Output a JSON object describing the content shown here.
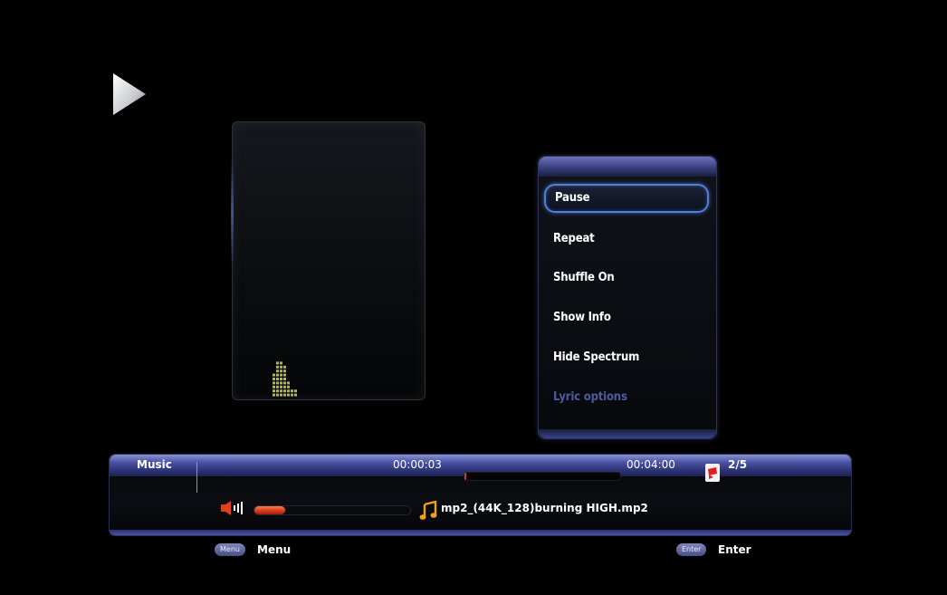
{
  "playback_state_icon": "play-icon",
  "menu": {
    "items": [
      {
        "label": "Pause",
        "selected": true,
        "enabled": true
      },
      {
        "label": "Repeat",
        "selected": false,
        "enabled": true
      },
      {
        "label": "Shuffle On",
        "selected": false,
        "enabled": true
      },
      {
        "label": "Show Info",
        "selected": false,
        "enabled": true
      },
      {
        "label": "Hide Spectrum",
        "selected": false,
        "enabled": true
      },
      {
        "label": "Lyric options",
        "selected": false,
        "enabled": false
      }
    ]
  },
  "info_bar": {
    "source_label": "Music",
    "current_time": "00:00:03",
    "total_time": "00:04:00",
    "progress_fraction": 0.0125,
    "track_position": "2/5",
    "volume_fraction": 0.2,
    "filename": "mp2_(44K_128)burning HIGH.mp2",
    "icons": {
      "volume": "speaker-volume-icon",
      "track": "playlist-icon",
      "file": "music-note-icon"
    }
  },
  "hints": {
    "menu_key": "Menu",
    "menu_label": "Menu",
    "enter_key": "Enter",
    "enter_label": "Enter"
  },
  "spectrum": {
    "levels": [
      3,
      6,
      5,
      4,
      2,
      1,
      1
    ]
  },
  "colors": {
    "accent": "#4b54a4",
    "selection_border": "#4f7fd9",
    "disabled_text": "#4f5aa0",
    "volume_fill": "#d83c1a",
    "spectrum": "#b8b83a",
    "music_note": "#f0a020"
  }
}
